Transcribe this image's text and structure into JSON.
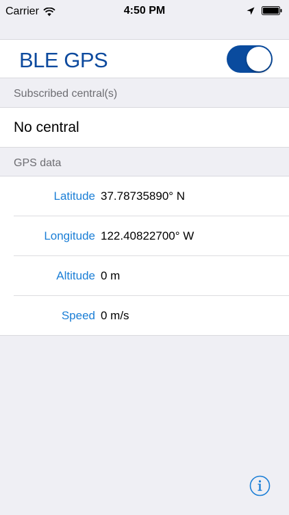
{
  "status_bar": {
    "carrier": "Carrier",
    "time": "4:50 PM",
    "icons": [
      "wifi-icon",
      "location-arrow-icon",
      "battery-icon"
    ]
  },
  "header": {
    "title": "BLE GPS",
    "toggle_on": true
  },
  "sections": {
    "subscribed_title": "Subscribed central(s)",
    "central_value": "No central",
    "gps_title": "GPS data"
  },
  "gps_rows": [
    {
      "label": "Latitude",
      "value": "37.78735890° N"
    },
    {
      "label": "Longitude",
      "value": "122.40822700° W"
    },
    {
      "label": "Altitude",
      "value": "0 m"
    },
    {
      "label": "Speed",
      "value": "0 m/s"
    }
  ],
  "colors": {
    "title": "#0d4a9e",
    "toggle": "#0a4b9e",
    "label": "#1a7ed6",
    "background": "#efeff4"
  }
}
